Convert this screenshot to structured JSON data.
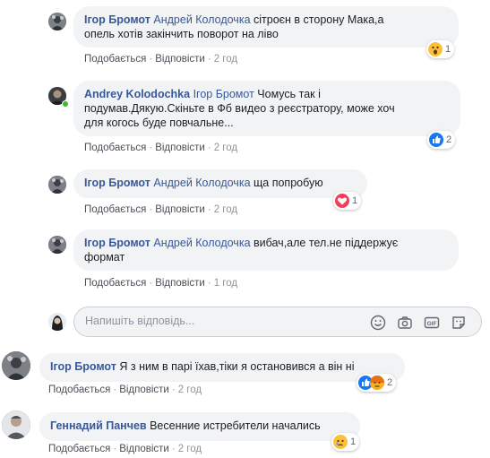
{
  "comments": [
    {
      "author": "Ігор Бромот",
      "mention": "Андрей Колодочка",
      "text_line1": " сітроєн в сторону Мака,а",
      "text_line2": "опель хотів закінчить поворот на ліво",
      "like": "Подобається",
      "reply": "Відповісти",
      "time": "2 год",
      "reaction_count": "1",
      "reaction": "wow"
    },
    {
      "author": "Andrey Kolodochka",
      "mention": "Ігор Бромот",
      "text_line1": " Чомусь так і",
      "text_line2": "подумав.Дякую.Скіньте в Фб видео з реєстратору, може хоч",
      "text_line3": "для когось буде повчальне...",
      "like": "Подобається",
      "reply": "Відповісти",
      "time": "2 год",
      "reaction_count": "2",
      "reaction": "like",
      "online": true
    },
    {
      "author": "Ігор Бромот",
      "mention": "Андрей Колодочка",
      "text_line1": " ща попробую",
      "like": "Подобається",
      "reply": "Відповісти",
      "time": "2 год",
      "reaction_count": "1",
      "reaction": "love"
    },
    {
      "author": "Ігор Бромот",
      "mention": "Андрей Колодочка",
      "text_line1": " вибач,але тел.не піддержує",
      "text_line2": "формат",
      "like": "Подобається",
      "reply": "Відповісти",
      "time": "1 год"
    },
    {
      "author": "Ігор Бромот",
      "text_line1": " Я з ним в парі їхав,тіки я остановився а він ні",
      "like": "Подобається",
      "reply": "Відповісти",
      "time": "2 год",
      "reaction_count": "2",
      "reaction": "like-angry"
    },
    {
      "author": "Геннадий Панчев",
      "text_line1": " Весенние истребители начались",
      "like": "Подобається",
      "reply": "Відповісти",
      "time": "2 год",
      "reaction_count": "1",
      "reaction": "sad"
    }
  ],
  "reply_box": {
    "placeholder": "Напишіть відповідь...",
    "icons": [
      "emoji-icon",
      "camera-icon",
      "gif-icon",
      "sticker-icon"
    ]
  },
  "colors": {
    "link": "#385898",
    "bubble": "#f2f3f5",
    "like_blue": "#1877f2",
    "love_red": "#f33e58",
    "reaction_yellow": "#fcc03b",
    "online_green": "#42b72a"
  }
}
